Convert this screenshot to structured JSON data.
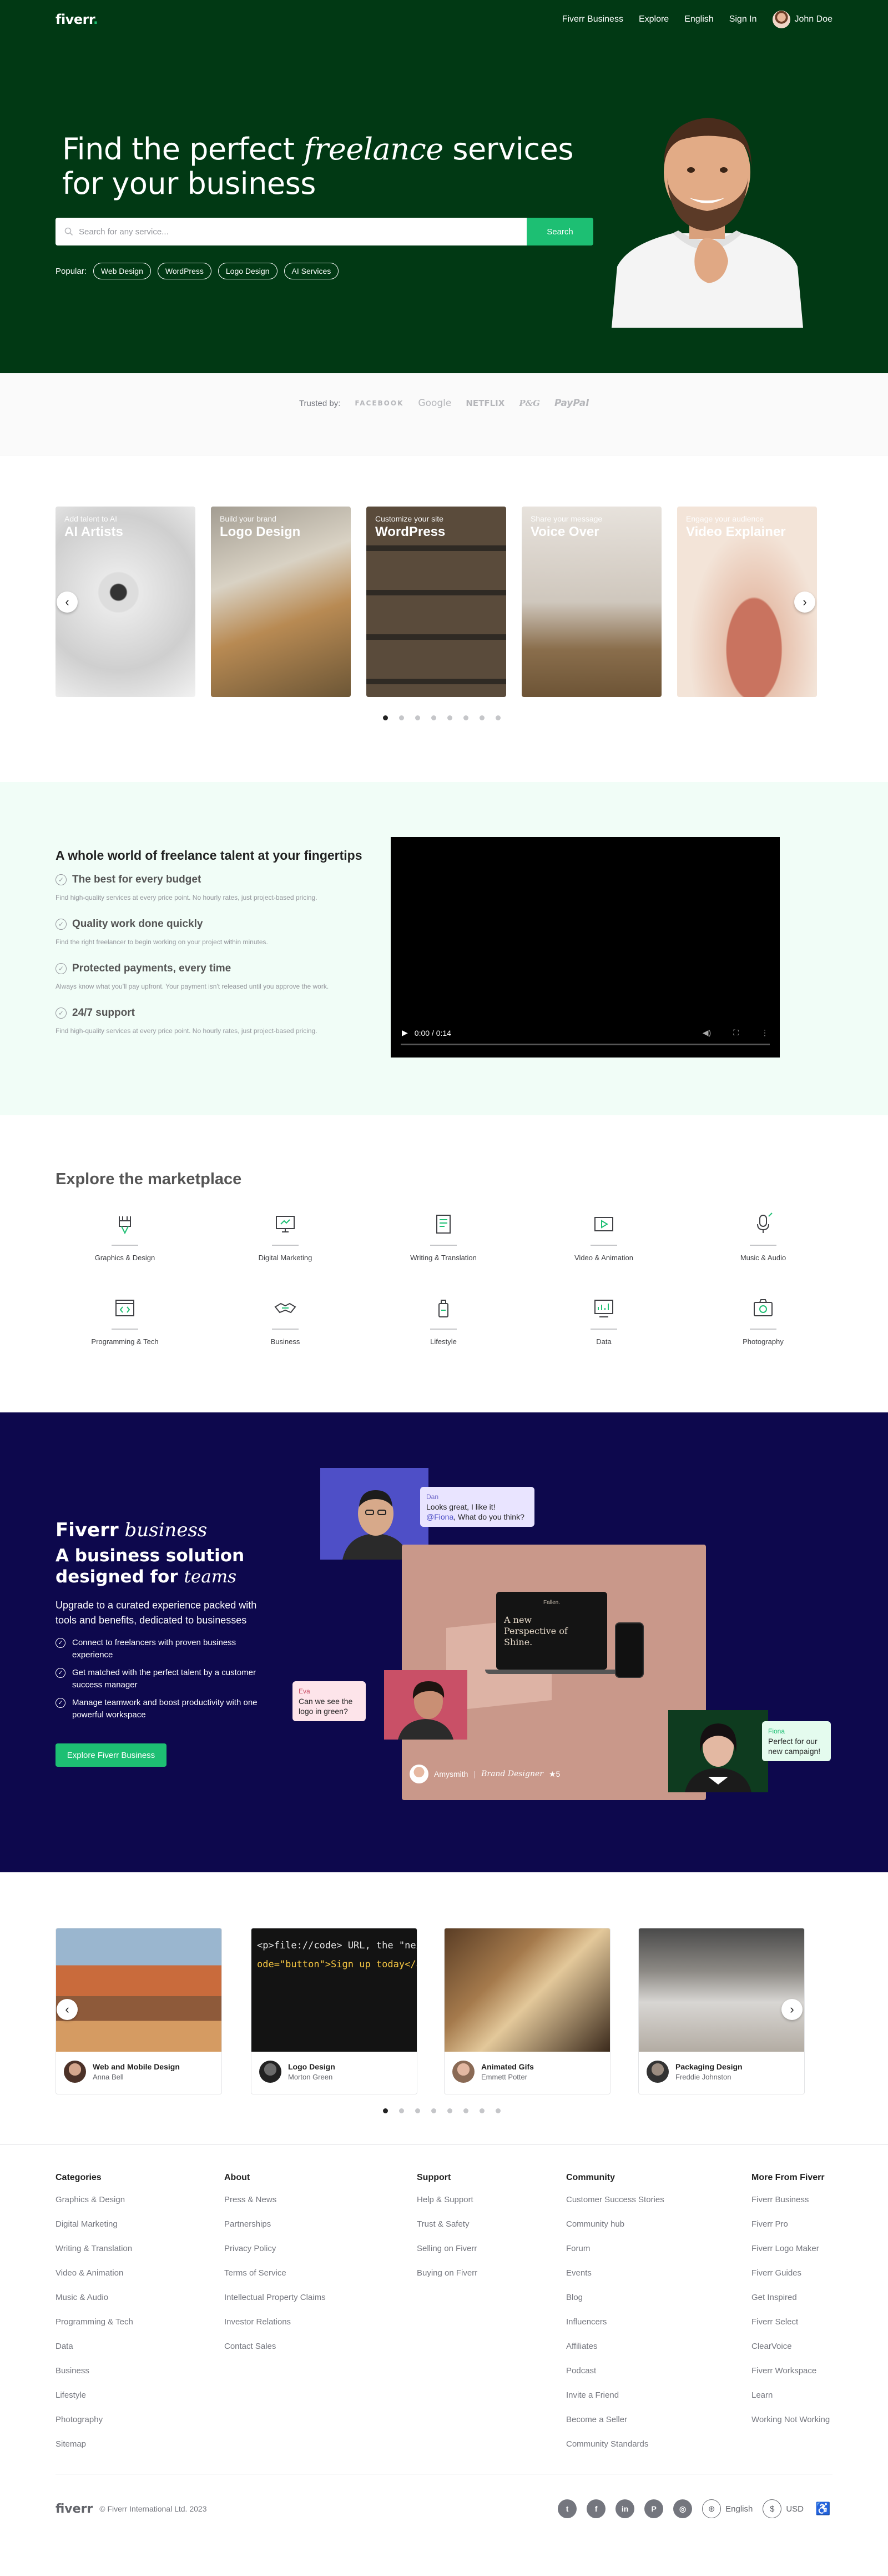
{
  "nav": {
    "logo": "fiverr",
    "links": [
      "Fiverr Business",
      "Explore",
      "English",
      "Sign In"
    ],
    "user_name": "John Doe"
  },
  "hero": {
    "title_pre": "Find the perfect ",
    "title_italic": "freelance",
    "title_post": " services for your business",
    "search_placeholder": "Search for any service...",
    "search_button": "Search",
    "popular_label": "Popular:",
    "popular_tags": [
      "Web Design",
      "WordPress",
      "Logo Design",
      "AI Services"
    ]
  },
  "trusted": {
    "label": "Trusted by:",
    "brands": [
      "FACEBOOK",
      "Google",
      "NETFLIX",
      "P&G",
      "PayPal"
    ]
  },
  "services": {
    "cards": [
      {
        "subtitle": "Add talent to AI",
        "title": "AI Artists"
      },
      {
        "subtitle": "Build your brand",
        "title": "Logo Design"
      },
      {
        "subtitle": "Customize your site",
        "title": "WordPress"
      },
      {
        "subtitle": "Share your message",
        "title": "Voice Over"
      },
      {
        "subtitle": "Engage your audience",
        "title": "Video Explainer"
      }
    ],
    "dot_count": 8,
    "active_dot": 0
  },
  "features": {
    "title": "A whole world of freelance talent at your fingertips",
    "items": [
      {
        "heading": "The best for every budget",
        "text": "Find high-quality services at every price point. No hourly rates, just project-based pricing."
      },
      {
        "heading": "Quality work done quickly",
        "text": "Find the right freelancer to begin working on your project within minutes."
      },
      {
        "heading": "Protected payments, every time",
        "text": "Always know what you'll pay upfront. Your payment isn't released until you approve the work."
      },
      {
        "heading": "24/7 support",
        "text": "Find high-quality services at every price point. No hourly rates, just project-based pricing."
      }
    ],
    "video_time": "0:00 / 0:14",
    "video_progress": 0
  },
  "market": {
    "title": "Explore the marketplace",
    "categories": [
      "Graphics & Design",
      "Digital Marketing",
      "Writing & Translation",
      "Video & Animation",
      "Music & Audio",
      "Programming & Tech",
      "Business",
      "Lifestyle",
      "Data",
      "Photography"
    ]
  },
  "business": {
    "logo_bold": "Fiverr",
    "logo_italic": " business",
    "heading_pre": "A business solution designed for ",
    "heading_italic": "teams",
    "description": "Upgrade to a curated experience packed with tools and benefits, dedicated to businesses",
    "bullets": [
      "Connect to freelancers with proven business experience",
      "Get matched with the perfect talent by a customer success manager",
      "Manage teamwork and boost productivity with one powerful workspace"
    ],
    "button": "Explore Fiverr Business",
    "bubble1": {
      "name": "Dan",
      "line1": "Looks great, I like it!",
      "mention": "@Fiona",
      "line2": ", What do you think?"
    },
    "bubble2": {
      "name": "Eva",
      "text": "Can we see the logo in green?"
    },
    "bubble3": {
      "name": "Fiona",
      "text": "Perfect for our new campaign!"
    },
    "mock_brand": "Fallen.",
    "mock_headline": "A new Perspective of Shine.",
    "seller_name": "Amysmith",
    "seller_role": "Brand Designer",
    "seller_rating": "★5"
  },
  "projects": {
    "items": [
      {
        "title": "Web and Mobile Design",
        "author": "Anna Bell"
      },
      {
        "title": "Logo Design",
        "author": "Morton Green"
      },
      {
        "title": "Animated Gifs",
        "author": "Emmett Potter"
      },
      {
        "title": "Packaging Design",
        "author": "Freddie Johnston"
      }
    ],
    "code_line1": "<p>file://code> URL, the \"next\"",
    "code_line2": "ode=\"button\">Sign up today</a>",
    "dot_count": 8,
    "active_dot": 0
  },
  "footer": {
    "columns": [
      {
        "title": "Categories",
        "links": [
          "Graphics & Design",
          "Digital Marketing",
          "Writing & Translation",
          "Video & Animation",
          "Music & Audio",
          "Programming & Tech",
          "Data",
          "Business",
          "Lifestyle",
          "Photography",
          "Sitemap"
        ]
      },
      {
        "title": "About",
        "links": [
          "Press & News",
          "Partnerships",
          "Privacy Policy",
          "Terms of Service",
          "Intellectual Property Claims",
          "Investor Relations",
          "Contact Sales"
        ]
      },
      {
        "title": "Support",
        "links": [
          "Help & Support",
          "Trust & Safety",
          "Selling on Fiverr",
          "Buying on Fiverr"
        ]
      },
      {
        "title": "Community",
        "links": [
          "Customer Success Stories",
          "Community hub",
          "Forum",
          "Events",
          "Blog",
          "Influencers",
          "Affiliates",
          "Podcast",
          "Invite a Friend",
          "Become a Seller",
          "Community Standards"
        ]
      },
      {
        "title": "More From Fiverr",
        "links": [
          "Fiverr Business",
          "Fiverr Pro",
          "Fiverr Logo Maker",
          "Fiverr Guides",
          "Get Inspired",
          "Fiverr Select",
          "ClearVoice",
          "Fiverr Workspace",
          "Learn",
          "Working Not Working"
        ]
      }
    ],
    "logo": "fiverr",
    "copyright": "© Fiverr International Ltd. 2023",
    "language": "English",
    "currency": "USD",
    "currency_symbol": "$",
    "social_icons": [
      "twitter-icon",
      "facebook-icon",
      "linkedin-icon",
      "pinterest-icon",
      "instagram-icon"
    ]
  },
  "colors": {
    "hero_bg": "#013914",
    "accent": "#1dbf73",
    "features_bg": "#f1fdf7",
    "business_bg": "#0d084d"
  }
}
